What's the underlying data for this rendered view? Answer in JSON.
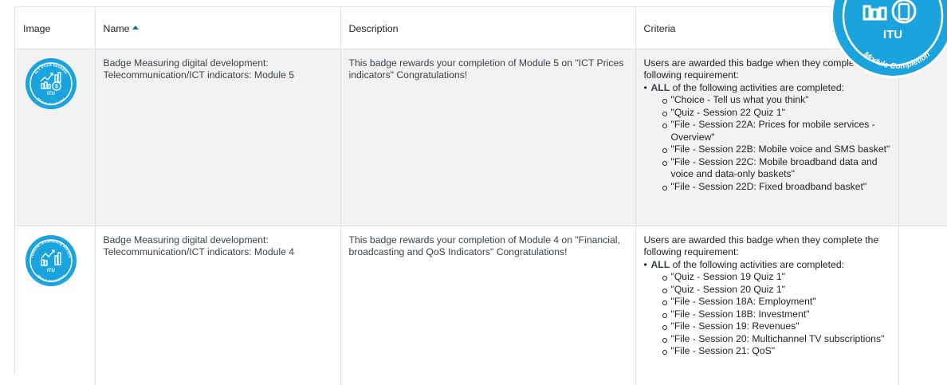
{
  "table": {
    "headers": {
      "image": "Image",
      "name": "Name",
      "description": "Description",
      "criteria": "Criteria"
    },
    "rows": [
      {
        "badge_ring_text": "ICT Price baskets",
        "badge_bottom_text": "Module Completion",
        "badge_org": "ITU",
        "name": "Badge Measuring digital development: Telecommunication/ICT indicators: Module 5",
        "description": "This badge rewards your completion of Module 5 on \"ICT Prices indicators\" Congratulations!",
        "criteria_intro": "Users are awarded this badge when they complete the following requirement:",
        "criteria_all_word": "ALL",
        "criteria_all_rest": " of the following activities are completed:",
        "activities": [
          "\"Choice - Tell us what you think\"",
          "\"Quiz - Session 22 Quiz 1\"",
          "\"File - Session 22A: Prices for mobile services - Overview\"",
          "\"File - Session 22B: Mobile voice and SMS basket\"",
          "\"File - Session 22C: Mobile broadband data and voice and data-only baskets\"",
          "\"File - Session 22D: Fixed broadband basket\""
        ]
      },
      {
        "badge_ring_text": "Financial, broadcasting and QoS",
        "badge_bottom_text": "Module Completion",
        "badge_org": "ITU",
        "name": "Badge Measuring digital development: Telecommunication/ICT indicators: Module 4",
        "description": "This badge rewards your completion of Module 4 on \"Financial, broadcasting and QoS Indicators\" Congratulations!",
        "criteria_intro": "Users are awarded this badge when they complete the following requirement:",
        "criteria_all_word": "ALL",
        "criteria_all_rest": " of the following activities are completed:",
        "activities": [
          "\"Quiz - Session 19 Quiz 1\"",
          "\"Quiz - Session 20 Quiz 1\"",
          "\"File - Session 18A: Employment\"",
          "\"File - Session 18B: Investment\"",
          "\"File - Session 19: Revenues\"",
          "\"File - Session 20: Multichannel TV subscriptions\"",
          "\"File - Session 21: QoS\""
        ]
      }
    ]
  },
  "corner_badge": {
    "org": "ITU",
    "ring_text": "Module Completion"
  },
  "colors": {
    "badge_blue": "#1aa3dc",
    "row_highlight": "#f2f2f2",
    "sort_arrow": "#0f6cbf"
  }
}
